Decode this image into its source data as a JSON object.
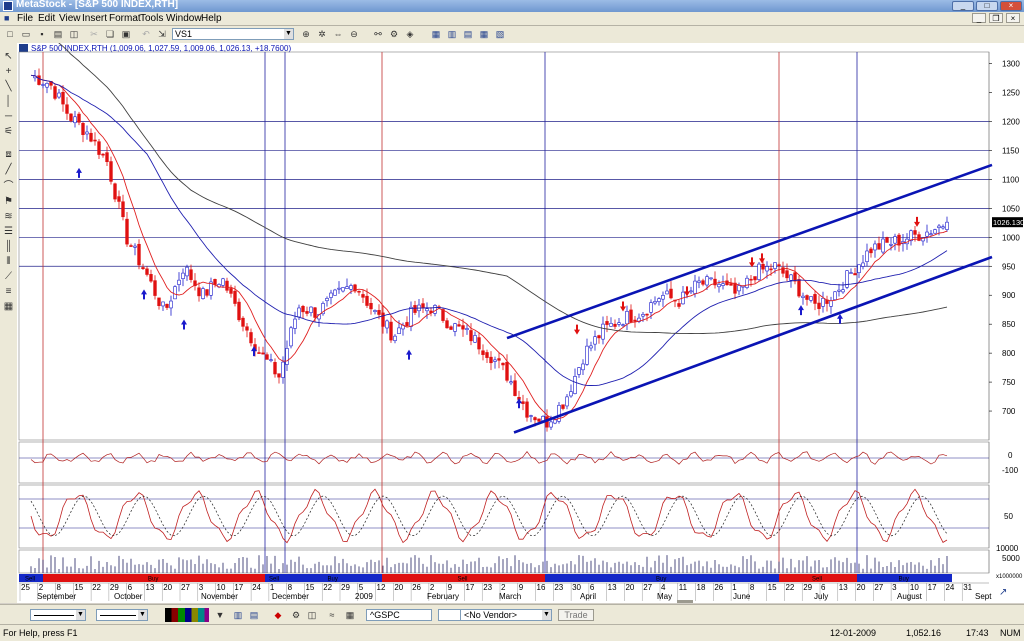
{
  "window": {
    "title": "MetaStock - [S&P 500 INDEX,RTH]"
  },
  "menu": [
    "File",
    "Edit",
    "View",
    "Insert",
    "Format",
    "Tools",
    "Window",
    "Help"
  ],
  "toolbar": {
    "layout_combo": "VS1"
  },
  "chart": {
    "header": "S&P 500 INDEX,RTH (1,009.06, 1,027.59, 1,009.06, 1,026.13, +18.7600)",
    "price_axis_labels": [
      "1300",
      "1250",
      "1200",
      "1150",
      "1100",
      "1050",
      "1000",
      "950",
      "900",
      "850",
      "800",
      "750",
      "700"
    ],
    "current_price_label": "1026.130",
    "indicator1_axis": [
      "0",
      "-100"
    ],
    "indicator2_axis": [
      "50"
    ],
    "volume_axis": [
      "10000",
      "5000"
    ],
    "volume_unit": "x1000000",
    "date_ticks": [
      "25",
      "2",
      "8",
      "15",
      "22",
      "29",
      "6",
      "13",
      "20",
      "27",
      "3",
      "10",
      "17",
      "24",
      "1",
      "8",
      "15",
      "22",
      "29",
      "5",
      "12",
      "20",
      "26",
      "2",
      "9",
      "17",
      "23",
      "2",
      "9",
      "16",
      "23",
      "30",
      "6",
      "13",
      "20",
      "27",
      "4",
      "11",
      "18",
      "26",
      "1",
      "8",
      "15",
      "22",
      "29",
      "6",
      "13",
      "20",
      "27",
      "3",
      "10",
      "17",
      "24",
      "31"
    ],
    "month_labels": [
      "September",
      "October",
      "November",
      "December",
      "2009",
      "February",
      "March",
      "April",
      "May",
      "June",
      "July",
      "August",
      "Sept"
    ],
    "band_labels": [
      "Sell",
      "Buy",
      "Sell",
      "Buy",
      "Sell",
      "Buy",
      "Sell",
      "Buy"
    ],
    "colors": {
      "up": "#1a1acc",
      "down": "#e01010",
      "channel": "#0a14b4",
      "ma_red": "#e02020",
      "ma_blue": "#2020b0",
      "ma_black": "#404040"
    },
    "chart_data": {
      "type": "candlestick",
      "title": "S&P 500 INDEX,RTH",
      "period": "Aug 2008 - Aug 2009",
      "ylim": [
        650,
        1320
      ],
      "last_close": 1026.13,
      "series": [
        {
          "name": "close_approx",
          "points": [
            1280,
            1265,
            1210,
            1180,
            1130,
            1000,
            940,
            870,
            950,
            900,
            930,
            860,
            800,
            760,
            880,
            870,
            900,
            920,
            870,
            830,
            870,
            880,
            850,
            830,
            800,
            760,
            700,
            680,
            720,
            800,
            840,
            860,
            870,
            900,
            890,
            920,
            920,
            900,
            940,
            950,
            920,
            880,
            900,
            940,
            980,
            990,
            1000,
            1010,
            1026
          ]
        }
      ]
    }
  },
  "bottom": {
    "symbol": "^GSPC",
    "vendor": "<No Vendor>",
    "trade_label": "Trade"
  },
  "status": {
    "help": "For Help, press F1",
    "date": "12-01-2009",
    "value": "1,052.16",
    "time": "17:43",
    "num": "NUM"
  }
}
